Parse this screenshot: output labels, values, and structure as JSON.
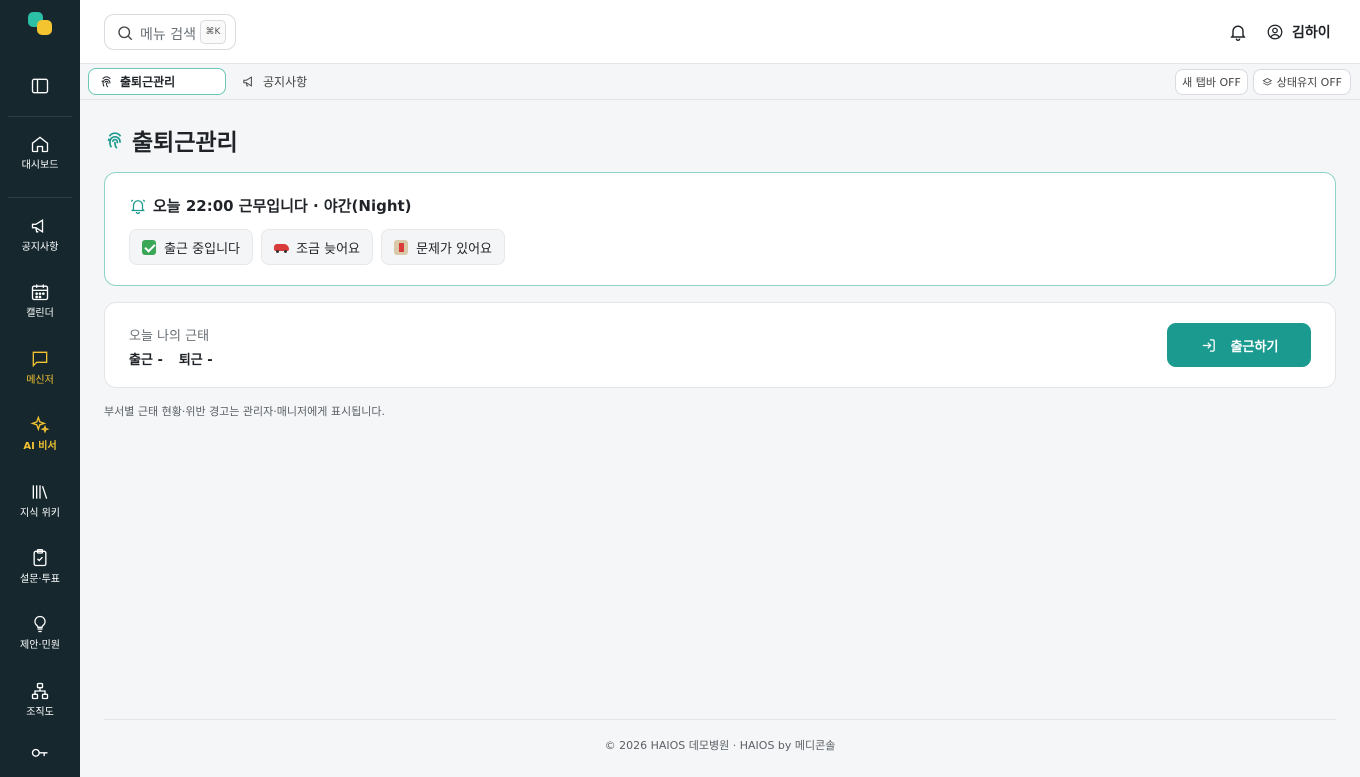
{
  "sidebar": {
    "items": [
      {
        "label": "대시보드",
        "icon": "home-icon"
      },
      {
        "label": "공지사항",
        "icon": "megaphone-icon"
      },
      {
        "label": "캘린더",
        "icon": "calendar-icon"
      },
      {
        "label": "메신저",
        "icon": "message-icon"
      },
      {
        "label": "AI 비서",
        "icon": "sparkles-icon"
      },
      {
        "label": "지식 위키",
        "icon": "library-icon"
      },
      {
        "label": "설문·투표",
        "icon": "clipboard-check-icon"
      },
      {
        "label": "제안·민원",
        "icon": "lightbulb-icon"
      },
      {
        "label": "조직도",
        "icon": "org-chart-icon"
      }
    ],
    "accent_color": "#f2c230",
    "background": "#16282e"
  },
  "header": {
    "search_placeholder": "메뉴 검색",
    "search_shortcut": "⌘K",
    "user_name": "김하이"
  },
  "tabs": {
    "items": [
      {
        "label": "출퇴근관리",
        "icon": "fingerprint-icon",
        "active": true
      },
      {
        "label": "공지사항",
        "icon": "megaphone-icon",
        "active": false
      }
    ],
    "new_tab_toggle": "새 탭바 OFF",
    "keep_state_toggle": "상태유지 OFF"
  },
  "main": {
    "title": "출퇴근관리",
    "shift_message": "오늘 22:00 근무입니다 · 야간(Night)",
    "quick_buttons": [
      {
        "label": "출근 중입니다",
        "emoji": "check-mark-emoji"
      },
      {
        "label": "조금 늦어요",
        "emoji": "car-emoji"
      },
      {
        "label": "문제가 있어요",
        "emoji": "hospital-emoji"
      }
    ],
    "attendance": {
      "title": "오늘 나의 근태",
      "check_in": "출근 -",
      "check_out": "퇴근 -"
    },
    "check_in_button": "출근하기",
    "note": "부서별 근태 현황·위반 경고는 관리자·매니저에게 표시됩니다."
  },
  "footer": {
    "text": "© 2026 HAIOS 데모병원 · HAIOS by 메디콘솔"
  },
  "colors": {
    "primary": "#1b9a8f",
    "highlight_border": "#8ed3c6"
  }
}
